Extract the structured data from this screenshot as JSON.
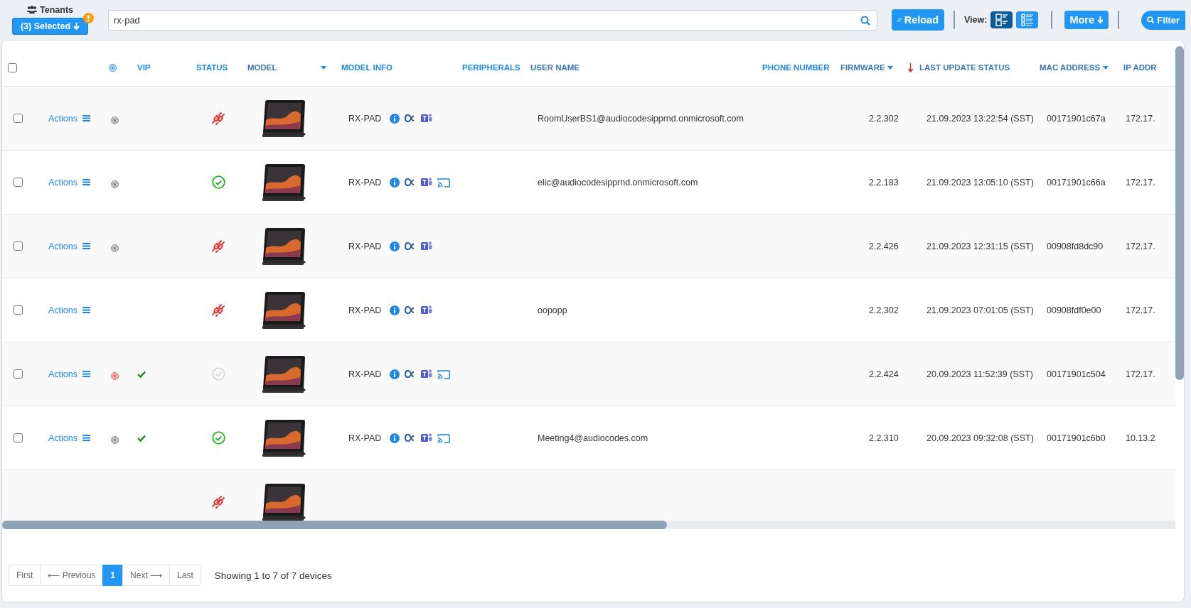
{
  "tenants": {
    "label": "Tenants",
    "selected_button": "(3) Selected",
    "warning": true
  },
  "search": {
    "value": "rx-pad"
  },
  "toolbar": {
    "reload": "Reload",
    "view_label": "View:",
    "views": [
      {
        "kind": "cards",
        "selected": true
      },
      {
        "kind": "list",
        "selected": false
      }
    ],
    "more": "More",
    "filter": "Filter"
  },
  "table": {
    "select_all_checked": false,
    "columns": [
      {
        "kind": "check"
      },
      {
        "kind": "blank"
      },
      {
        "kind": "presence"
      },
      {
        "kind": "text",
        "label": "VIP",
        "sortable": false,
        "caret": false
      },
      {
        "kind": "text",
        "label": "STATUS",
        "sortable": false,
        "caret": false
      },
      {
        "kind": "text",
        "label": "MODEL",
        "sortable": true,
        "caret": true
      },
      {
        "kind": "text",
        "label": "MODEL INFO",
        "sortable": false,
        "caret": false
      },
      {
        "kind": "text",
        "label": "PERIPHERALS",
        "sortable": false,
        "caret": false
      },
      {
        "kind": "text",
        "label": "USER NAME",
        "sortable": true,
        "caret": false
      },
      {
        "kind": "text",
        "label": "PHONE NUMBER",
        "sortable": false,
        "caret": false
      },
      {
        "kind": "text",
        "label": "FIRMWARE",
        "sortable": true,
        "caret": true
      },
      {
        "kind": "text",
        "label": "LAST UPDATE STATUS",
        "sortable": true,
        "caret": false,
        "sorted_descending": true
      },
      {
        "kind": "text",
        "label": "MAC ADDRESS",
        "sortable": true,
        "caret": true
      },
      {
        "kind": "text",
        "label": "IP ADDR",
        "sortable": true,
        "caret": false
      }
    ],
    "rows": [
      {
        "checked": false,
        "actions": "Actions",
        "presence": {
          "kind": "normal"
        },
        "vip": false,
        "status": {
          "kind": "disconnected"
        },
        "model_info": "RX-PAD",
        "cast": false,
        "user_name": "RoomUserBS1@audiocodesipprnd.onmicrosoft.com",
        "firmware": "2.2.302",
        "last_update": "21.09.2023 13:22:54 (SST)",
        "mac": "00171901c67a",
        "ip": "172.17."
      },
      {
        "checked": false,
        "actions": "Actions",
        "presence": {
          "kind": "normal"
        },
        "vip": false,
        "status": {
          "kind": "connected"
        },
        "model_info": "RX-PAD",
        "cast": true,
        "user_name": "elic@audiocodesipprnd.onmicrosoft.com",
        "firmware": "2.2.183",
        "last_update": "21.09.2023 13:05:10 (SST)",
        "mac": "00171901c66a",
        "ip": "172.17."
      },
      {
        "checked": false,
        "actions": "Actions",
        "presence": {
          "kind": "normal"
        },
        "vip": false,
        "status": {
          "kind": "disconnected"
        },
        "model_info": "RX-PAD",
        "cast": false,
        "firmware": "2.2.426",
        "last_update": "21.09.2023 12:31:15 (SST)",
        "mac": "00908fd8dc90",
        "ip": "172.17."
      },
      {
        "checked": false,
        "actions": "Actions",
        "vip": false,
        "status": {
          "kind": "disconnected"
        },
        "model_info": "RX-PAD",
        "cast": false,
        "user_name": "oopopp",
        "firmware": "2.2.302",
        "last_update": "21.09.2023 07:01:05 (SST)",
        "mac": "00908fdf0e00",
        "ip": "172.17."
      },
      {
        "checked": false,
        "actions": "Actions",
        "presence": {
          "kind": "alarm"
        },
        "vip": true,
        "status": {
          "kind": "unknown"
        },
        "model_info": "RX-PAD",
        "cast": true,
        "firmware": "2.2.424",
        "last_update": "20.09.2023 11:52:39 (SST)",
        "mac": "00171901c504",
        "ip": "172.17."
      },
      {
        "checked": false,
        "actions": "Actions",
        "presence": {
          "kind": "normal"
        },
        "vip": true,
        "status": {
          "kind": "connected"
        },
        "model_info": "RX-PAD",
        "cast": true,
        "user_name": "Meeting4@audiocodes.com",
        "firmware": "2.2.310",
        "last_update": "20.09.2023 09:32:08 (SST)",
        "mac": "00171901c6b0",
        "ip": "10.13.2"
      },
      {
        "status": {
          "kind": "disconnected"
        }
      }
    ]
  },
  "pagination": {
    "pages": [
      {
        "label": "First",
        "selected": false
      },
      {
        "label": "⟵ Previous",
        "selected": false
      },
      {
        "label": "1",
        "selected": true
      },
      {
        "label": "Next ⟶",
        "selected": false
      },
      {
        "label": "Last",
        "selected": false
      }
    ],
    "summary": "Showing 1 to 7 of 7 devices"
  }
}
